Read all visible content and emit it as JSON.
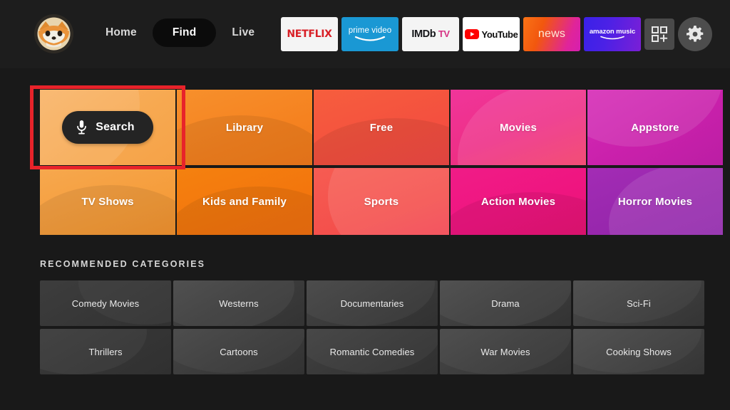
{
  "topbar": {
    "avatar_name": "profile-avatar",
    "nav": [
      {
        "label": "Home",
        "active": false
      },
      {
        "label": "Find",
        "active": true
      },
      {
        "label": "Live",
        "active": false
      }
    ],
    "apps": [
      {
        "id": "netflix",
        "label": "NETFLIX"
      },
      {
        "id": "prime",
        "label": "prime video"
      },
      {
        "id": "imdb",
        "label": "IMDb",
        "label2": "TV"
      },
      {
        "id": "youtube",
        "label": "YouTube"
      },
      {
        "id": "news",
        "label": "news"
      },
      {
        "id": "amazonmusic",
        "label": "amazon",
        "label2": "music"
      }
    ],
    "apps_grid_button": "app-grid-add-button",
    "settings_button": "settings-gear-button"
  },
  "tiles": {
    "row1": [
      {
        "label": "Search",
        "focused": true
      },
      {
        "label": "Library",
        "focused": false
      },
      {
        "label": "Free",
        "focused": false
      },
      {
        "label": "Movies",
        "focused": false
      },
      {
        "label": "Appstore",
        "focused": false
      }
    ],
    "row2": [
      {
        "label": "TV Shows"
      },
      {
        "label": "Kids and Family"
      },
      {
        "label": "Sports"
      },
      {
        "label": "Action Movies"
      },
      {
        "label": "Horror Movies"
      }
    ]
  },
  "recommended": {
    "heading": "RECOMMENDED CATEGORIES",
    "row1": [
      "Comedy Movies",
      "Westerns",
      "Documentaries",
      "Drama",
      "Sci-Fi"
    ],
    "row2": [
      "Thrillers",
      "Cartoons",
      "Romantic Comedies",
      "War Movies",
      "Cooking Shows"
    ]
  },
  "colors": {
    "background": "#191919",
    "topbar": "#1d1d1d",
    "focus_ring": "#e8232a",
    "search_tile": "#f6a94e",
    "library_tile": "#f58220",
    "free_tile": "#f4553f",
    "movies_tile": "#ef2d78",
    "appstore_tile": "#c81fae",
    "tvshows_tile": "#f5a040",
    "kids_tile": "#f4760e",
    "sports_tile": "#f4544e",
    "action_tile": "#ef1580",
    "horror_tile": "#9c27b0",
    "category_tile": "#3a3a3a"
  }
}
